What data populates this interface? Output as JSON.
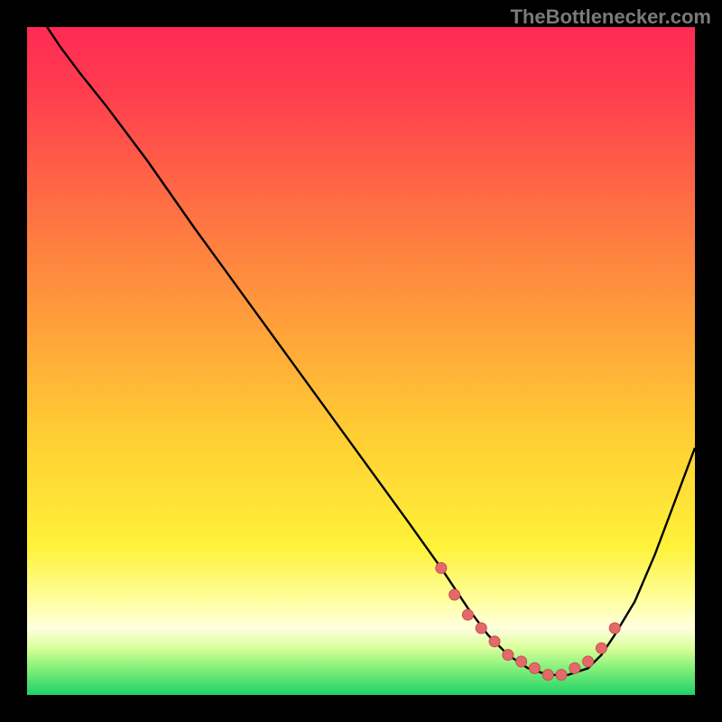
{
  "watermark": "TheBottlenecker.com",
  "colors": {
    "bg": "#000000",
    "curve": "#000000",
    "dot_fill": "#e36a6a",
    "dot_stroke": "#c94e4e",
    "gradient_stops": [
      {
        "offset": 0.0,
        "color": "#ff2a54"
      },
      {
        "offset": 0.1,
        "color": "#ff3e4e"
      },
      {
        "offset": 0.25,
        "color": "#ff6a45"
      },
      {
        "offset": 0.45,
        "color": "#ffa13a"
      },
      {
        "offset": 0.62,
        "color": "#ffd033"
      },
      {
        "offset": 0.78,
        "color": "#fff23a"
      },
      {
        "offset": 0.86,
        "color": "#ffffa1"
      },
      {
        "offset": 0.9,
        "color": "#ffffe0"
      },
      {
        "offset": 0.93,
        "color": "#d9ff99"
      },
      {
        "offset": 0.96,
        "color": "#84f07a"
      },
      {
        "offset": 1.0,
        "color": "#1fd167"
      }
    ]
  },
  "chart_data": {
    "type": "line",
    "title": "",
    "xlabel": "",
    "ylabel": "",
    "xlim": [
      0,
      100
    ],
    "ylim": [
      0,
      100
    ],
    "series": [
      {
        "name": "curve",
        "x": [
          3,
          5,
          8,
          12,
          18,
          25,
          33,
          41,
          49,
          57,
          62,
          66,
          69,
          72,
          75,
          78,
          81,
          84,
          86,
          88,
          91,
          94,
          97,
          100
        ],
        "y": [
          100,
          97,
          93,
          88,
          80,
          70,
          59,
          48,
          37,
          26,
          19,
          13,
          9,
          6,
          4,
          3,
          3,
          4,
          6,
          9,
          14,
          21,
          29,
          37
        ]
      }
    ],
    "markers": {
      "name": "valley-dots",
      "x": [
        62,
        64,
        66,
        68,
        70,
        72,
        74,
        76,
        78,
        80,
        82,
        84,
        86,
        88
      ],
      "y": [
        19,
        15,
        12,
        10,
        8,
        6,
        5,
        4,
        3,
        3,
        4,
        5,
        7,
        10
      ]
    }
  }
}
